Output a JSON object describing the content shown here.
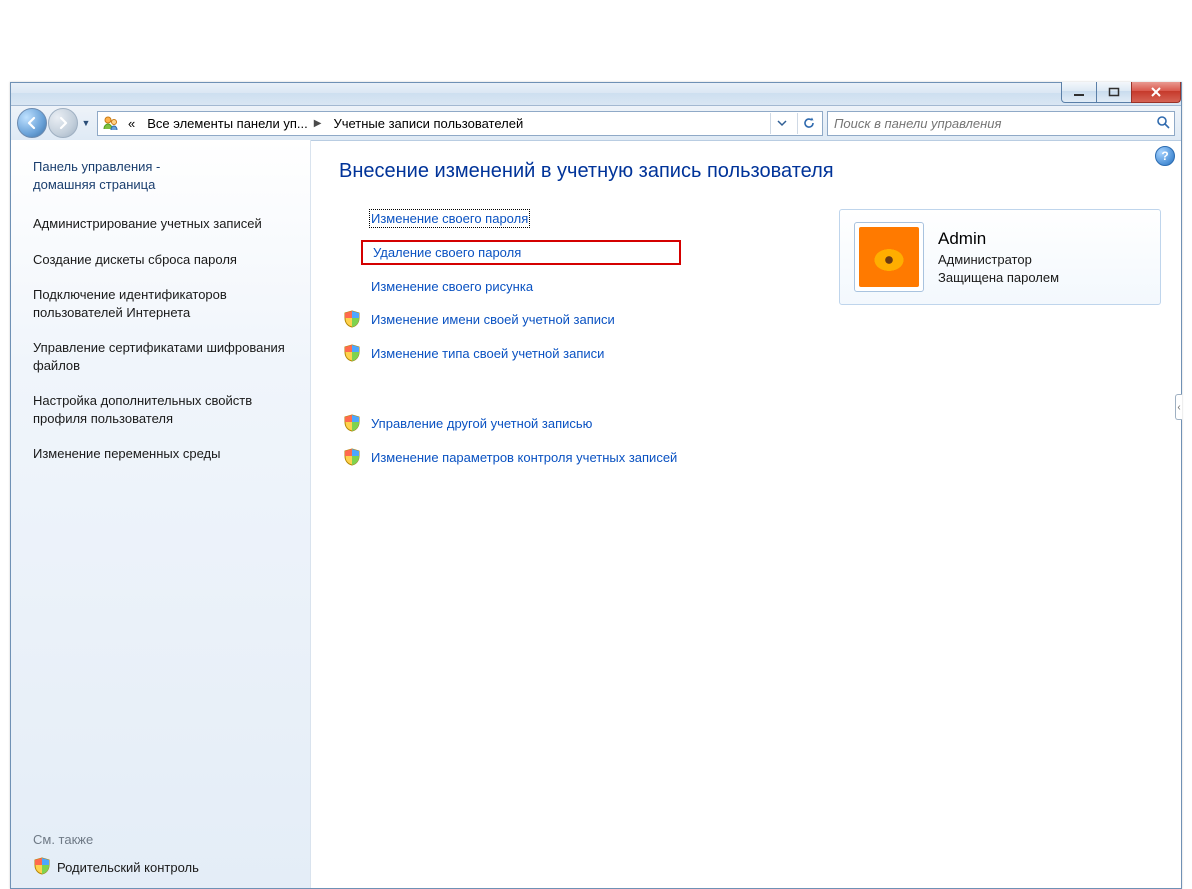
{
  "breadcrumb": {
    "part1": "Все элементы панели уп...",
    "part2": "Учетные записи пользователей",
    "overflow": "«"
  },
  "search": {
    "placeholder": "Поиск в панели управления"
  },
  "sidebar": {
    "home1": "Панель управления -",
    "home2": "домашняя страница",
    "tasks": [
      "Администрирование учетных записей",
      "Создание дискеты сброса пароля",
      "Подключение идентификаторов пользователей Интернета",
      "Управление сертификатами шифрования файлов",
      "Настройка дополнительных свойств профиля пользователя",
      "Изменение переменных среды"
    ],
    "see_also": "См. также",
    "parental": "Родительский контроль"
  },
  "main": {
    "heading": "Внесение изменений в учетную запись пользователя",
    "links": [
      {
        "label": "Изменение своего пароля",
        "shield": false,
        "focused": true,
        "highlighted": false
      },
      {
        "label": "Удаление своего пароля",
        "shield": false,
        "focused": false,
        "highlighted": true
      },
      {
        "label": "Изменение своего рисунка",
        "shield": false,
        "focused": false,
        "highlighted": false
      },
      {
        "label": "Изменение имени своей учетной записи",
        "shield": true,
        "focused": false,
        "highlighted": false
      },
      {
        "label": "Изменение типа своей учетной записи",
        "shield": true,
        "focused": false,
        "highlighted": false
      }
    ],
    "links2": [
      {
        "label": "Управление другой учетной записью",
        "shield": true
      },
      {
        "label": "Изменение параметров контроля учетных записей",
        "shield": true
      }
    ]
  },
  "user": {
    "name": "Admin",
    "role": "Администратор",
    "status": "Защищена паролем"
  }
}
